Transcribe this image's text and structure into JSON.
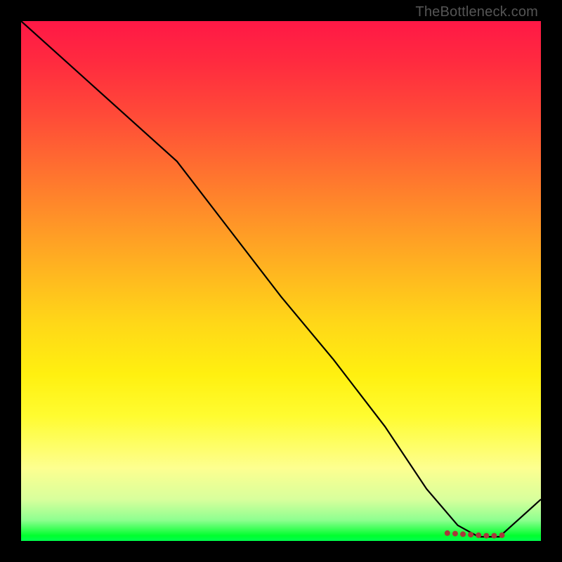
{
  "watermark": "TheBottleneck.com",
  "chart_data": {
    "type": "line",
    "title": "",
    "xlabel": "",
    "ylabel": "",
    "xlim": [
      0,
      100
    ],
    "ylim": [
      0,
      100
    ],
    "grid": false,
    "legend": false,
    "background_gradient": {
      "top": "#ff1846",
      "mid": "#ffd718",
      "bottom": "#00ff2e"
    },
    "series": [
      {
        "name": "curve",
        "color": "#000000",
        "x": [
          0,
          10,
          20,
          30,
          40,
          50,
          60,
          70,
          78,
          84,
          88,
          92,
          100
        ],
        "y": [
          100,
          91,
          82,
          73,
          60,
          47,
          35,
          22,
          10,
          3,
          0.8,
          0.8,
          8
        ]
      }
    ],
    "markers": {
      "color": "#a63a3a",
      "size": 4,
      "points": [
        {
          "x": 82,
          "y": 1.5
        },
        {
          "x": 83.5,
          "y": 1.4
        },
        {
          "x": 85,
          "y": 1.3
        },
        {
          "x": 86.5,
          "y": 1.2
        },
        {
          "x": 88,
          "y": 1.1
        },
        {
          "x": 89.5,
          "y": 1.0
        },
        {
          "x": 91,
          "y": 1.0
        },
        {
          "x": 92.5,
          "y": 1.1
        }
      ]
    }
  }
}
